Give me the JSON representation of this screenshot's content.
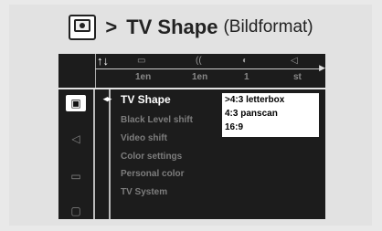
{
  "header": {
    "arrow": ">",
    "title": "TV Shape",
    "subtitle": "(Bildformat)"
  },
  "topbar": {
    "tool_icon": "↑↓",
    "items": [
      {
        "icon": "subtitle-icon",
        "glyph": "▭",
        "label": "1en"
      },
      {
        "icon": "audio-language-icon",
        "glyph": "((",
        "label": "1en"
      },
      {
        "icon": "disc-icon",
        "glyph": "◐",
        "label": "1"
      },
      {
        "icon": "speaker-icon",
        "glyph": "◁",
        "label": "st"
      }
    ]
  },
  "sidebar": {
    "items": [
      {
        "icon": "tv-icon",
        "glyph": "▣"
      },
      {
        "icon": "speaker-icon",
        "glyph": "◁"
      },
      {
        "icon": "message-icon",
        "glyph": "▭"
      },
      {
        "icon": "lock-icon",
        "glyph": "▢"
      }
    ]
  },
  "menu": {
    "cursor": "◂▸",
    "items": [
      {
        "label": "TV Shape"
      },
      {
        "label": "Black Level shift"
      },
      {
        "label": "Video shift"
      },
      {
        "label": "Color settings"
      },
      {
        "label": "Personal color"
      },
      {
        "label": "TV System"
      }
    ]
  },
  "options": {
    "items": [
      {
        "label": ">4:3 letterbox"
      },
      {
        "label": "4:3 panscan"
      },
      {
        "label": "16:9"
      }
    ]
  }
}
